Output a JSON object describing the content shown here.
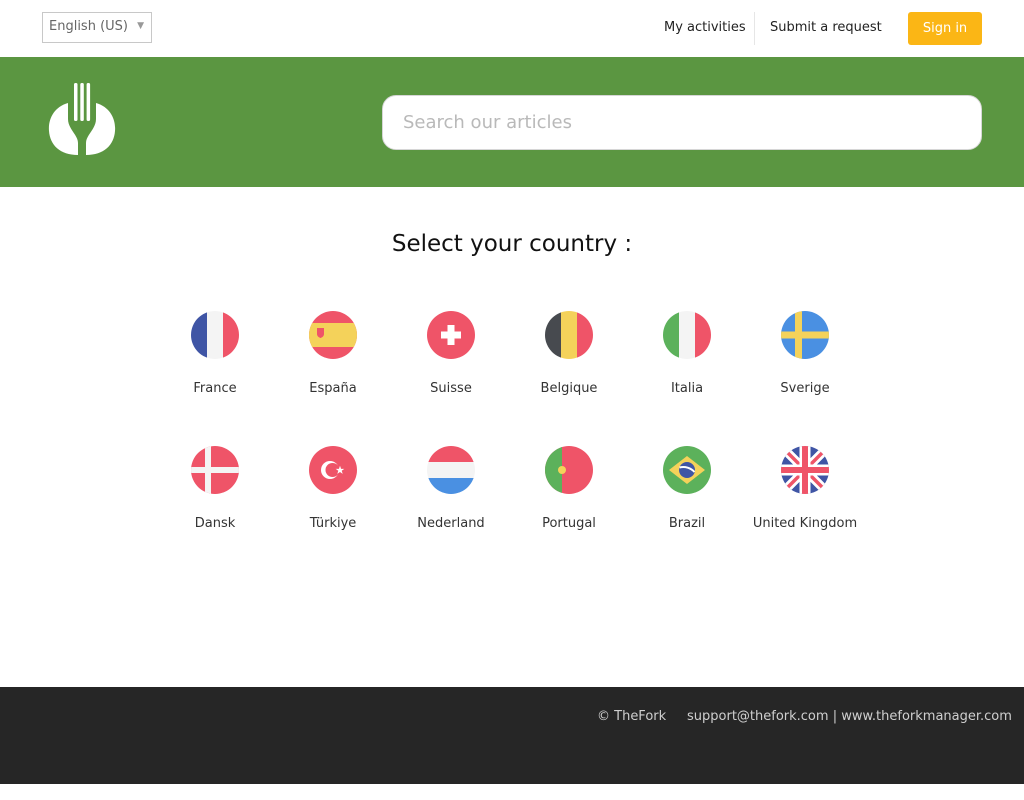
{
  "header": {
    "language": "English (US)",
    "nav": {
      "activities": "My activities",
      "request": "Submit a request",
      "signin": "Sign in"
    }
  },
  "hero": {
    "search_placeholder": "Search our articles",
    "brand_color": "#5b9641"
  },
  "section": {
    "title": "Select your country :"
  },
  "countries": [
    {
      "name": "France",
      "flag": "flag-fr"
    },
    {
      "name": "España",
      "flag": "flag-es"
    },
    {
      "name": "Suisse",
      "flag": "flag-ch"
    },
    {
      "name": "Belgique",
      "flag": "flag-be"
    },
    {
      "name": "Italia",
      "flag": "flag-it"
    },
    {
      "name": "Sverige",
      "flag": "flag-se"
    },
    {
      "name": "Dansk",
      "flag": "flag-dk"
    },
    {
      "name": "Türkiye",
      "flag": "flag-tr"
    },
    {
      "name": "Nederland",
      "flag": "flag-nl"
    },
    {
      "name": "Portugal",
      "flag": "flag-pt"
    },
    {
      "name": "Brazil",
      "flag": "flag-br"
    },
    {
      "name": "United Kingdom",
      "flag": "flag-gb"
    }
  ],
  "footer": {
    "copyright": "© TheFork",
    "email": "support@thefork.com",
    "separator": "|",
    "website": "www.theforkmanager.com"
  },
  "colors": {
    "accent": "#fbb615",
    "footer_bg": "#262626"
  }
}
